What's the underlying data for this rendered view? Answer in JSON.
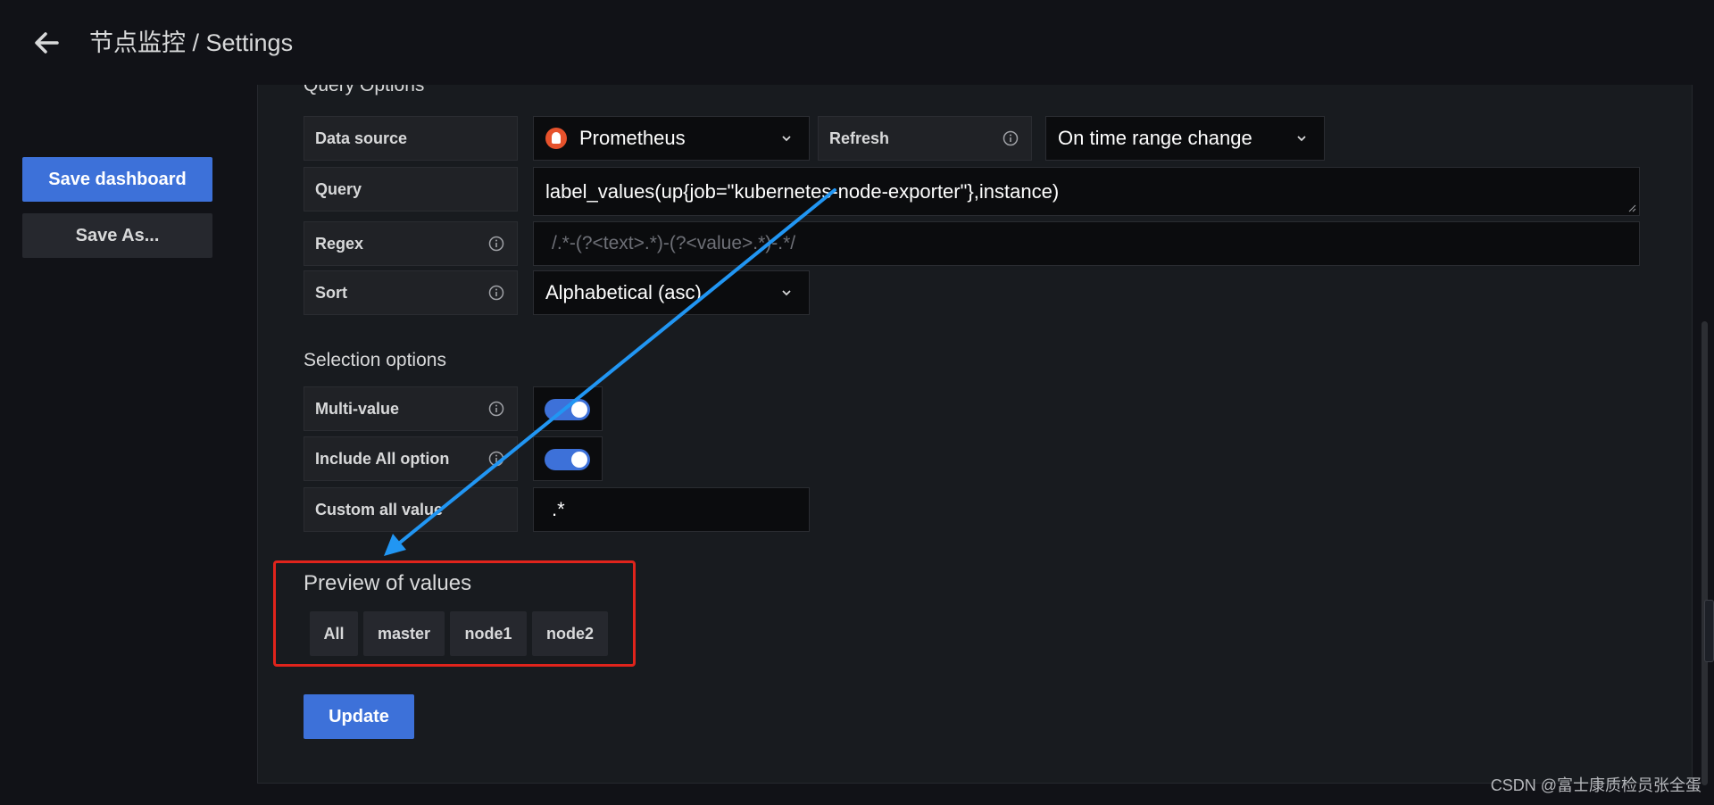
{
  "header": {
    "title": "节点监控 / Settings",
    "back_icon": "arrow-left-icon"
  },
  "sidebar": {
    "save_dashboard": "Save dashboard",
    "save_as": "Save As..."
  },
  "query_options": {
    "heading": "Query Options",
    "data_source_label": "Data source",
    "data_source_value": "Prometheus",
    "refresh_label": "Refresh",
    "refresh_value": "On time range change",
    "query_label": "Query",
    "query_value": "label_values(up{job=\"kubernetes-node-exporter\"},instance)",
    "regex_label": "Regex",
    "regex_placeholder": "/.*-(?<text>.*)-(?<value>.*)-.*/",
    "sort_label": "Sort",
    "sort_value": "Alphabetical (asc)"
  },
  "selection_options": {
    "heading": "Selection options",
    "multi_value_label": "Multi-value",
    "multi_value_on": true,
    "include_all_label": "Include All option",
    "include_all_on": true,
    "custom_all_label": "Custom all value",
    "custom_all_value": ".*"
  },
  "preview": {
    "heading": "Preview of values",
    "values": [
      "All",
      "master",
      "node1",
      "node2"
    ]
  },
  "actions": {
    "update": "Update"
  },
  "watermark": "CSDN @富士康质检员张全蛋",
  "colors": {
    "primary": "#3d71d9",
    "annotation_arrow": "#2196f3",
    "highlight_box": "#e0241c",
    "prometheus": "#e6522c"
  }
}
